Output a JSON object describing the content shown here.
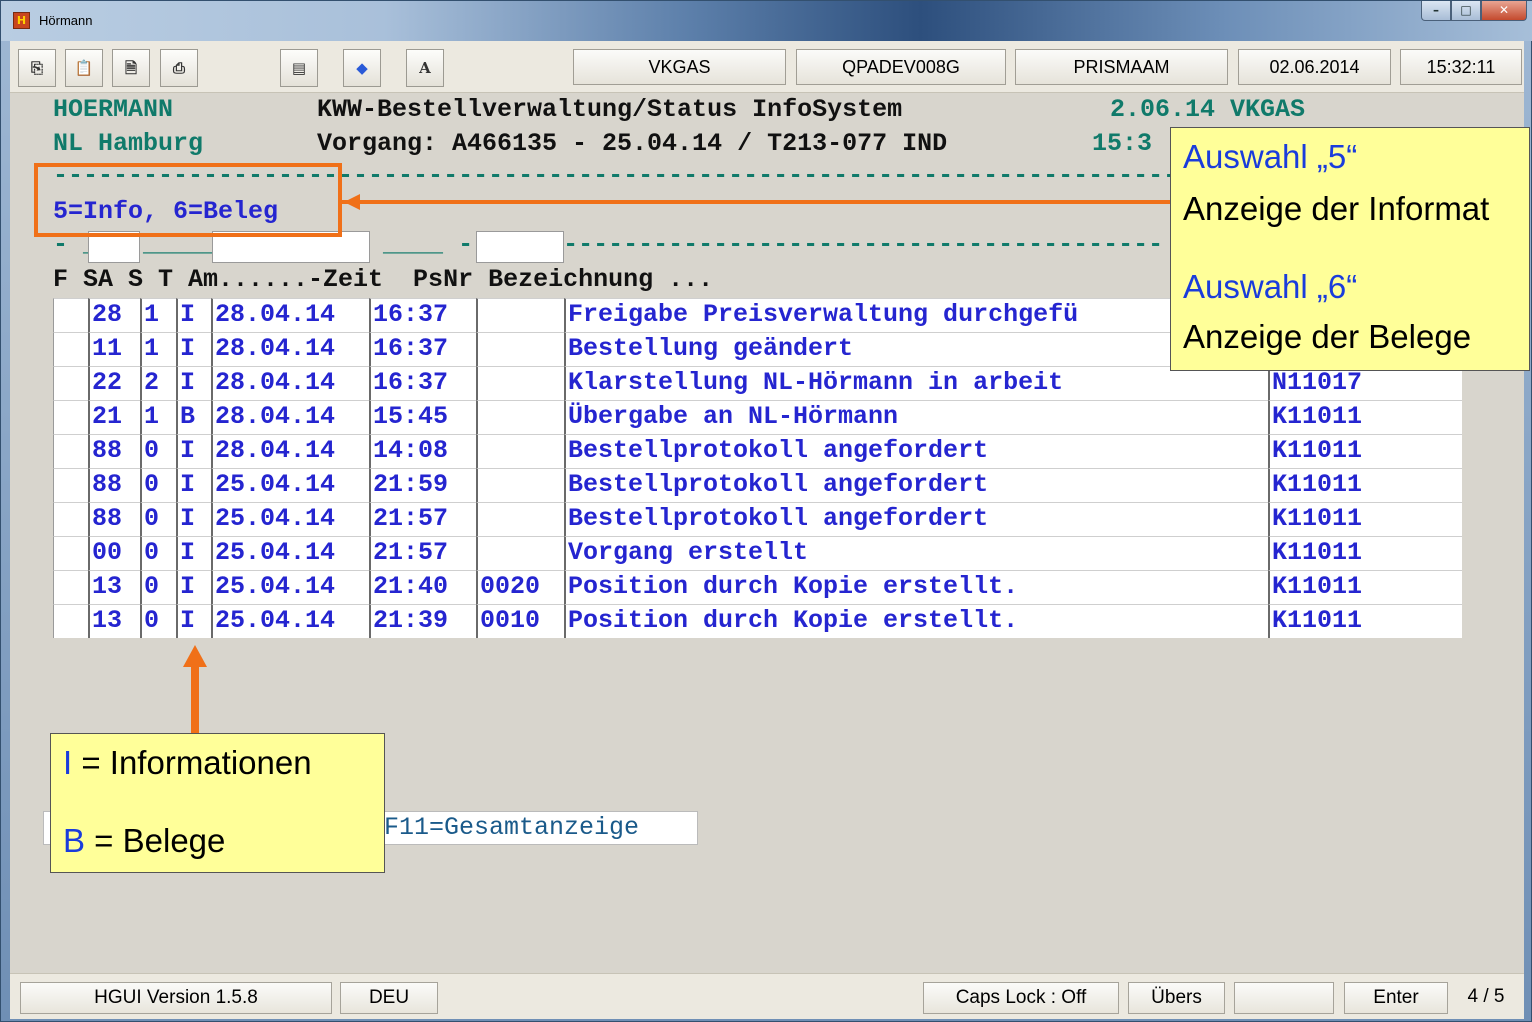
{
  "window": {
    "title": "Hörmann",
    "icon": "app-icon"
  },
  "toolbar": {
    "buttons": [
      "copy-icon",
      "paste-icon",
      "print-icon",
      "print-preview-icon",
      "print-screen-icon",
      "diamond-icon",
      "font-icon"
    ],
    "font_label": "A",
    "system": "VKGAS",
    "device": "QPADEV008G",
    "user": "PRISMAAM",
    "date": "02.06.2014",
    "time": "15:32:11"
  },
  "screen": {
    "company": "HOERMANN",
    "branch": "NL Hamburg",
    "title": "KWW-Bestellverwaltung/Status InfoSystem",
    "header_right": "2.06.14 VKGAS",
    "process_line": "Vorgang: A466135 - 25.04.14 / T213-077 IND",
    "process_time": "15:3",
    "options": "5=Info, 6=Beleg",
    "columns": "F SA S T Am......-Zeit  PsNr Bezeichnung ...",
    "rows": [
      {
        "sa": "28",
        "s": "1",
        "t": "I",
        "date": "28.04.14",
        "time": "16:37",
        "psnr": "",
        "desc": "Freigabe Preisverwaltung durchgefü",
        "user": ""
      },
      {
        "sa": "11",
        "s": "1",
        "t": "I",
        "date": "28.04.14",
        "time": "16:37",
        "psnr": "",
        "desc": "Bestellung geändert",
        "user": ""
      },
      {
        "sa": "22",
        "s": "2",
        "t": "I",
        "date": "28.04.14",
        "time": "16:37",
        "psnr": "",
        "desc": "Klarstellung NL-Hörmann in arbeit",
        "user": "N11017"
      },
      {
        "sa": "21",
        "s": "1",
        "t": "B",
        "date": "28.04.14",
        "time": "15:45",
        "psnr": "",
        "desc": "Übergabe an NL-Hörmann",
        "user": "K11011"
      },
      {
        "sa": "88",
        "s": "0",
        "t": "I",
        "date": "28.04.14",
        "time": "14:08",
        "psnr": "",
        "desc": "Bestellprotokoll angefordert",
        "user": "K11011"
      },
      {
        "sa": "88",
        "s": "0",
        "t": "I",
        "date": "25.04.14",
        "time": "21:59",
        "psnr": "",
        "desc": "Bestellprotokoll angefordert",
        "user": "K11011"
      },
      {
        "sa": "88",
        "s": "0",
        "t": "I",
        "date": "25.04.14",
        "time": "21:57",
        "psnr": "",
        "desc": "Bestellprotokoll angefordert",
        "user": "K11011"
      },
      {
        "sa": "00",
        "s": "0",
        "t": "I",
        "date": "25.04.14",
        "time": "21:57",
        "psnr": "",
        "desc": "Vorgang erstellt",
        "user": "K11011"
      },
      {
        "sa": "13",
        "s": "0",
        "t": "I",
        "date": "25.04.14",
        "time": "21:40",
        "psnr": "0020",
        "desc": "Position durch Kopie erstellt.",
        "user": "K11011"
      },
      {
        "sa": "13",
        "s": "0",
        "t": "I",
        "date": "25.04.14",
        "time": "21:39",
        "psnr": "0010",
        "desc": "Position durch Kopie erstellt.",
        "user": "K11011"
      }
    ],
    "fkeys": "F11=Gesamtanzeige"
  },
  "callouts": {
    "right": {
      "line1_key": "Auswahl „5“",
      "line1_desc": "Anzeige der Informat",
      "line2_key": "Auswahl „6“",
      "line2_desc": "Anzeige der Belege"
    },
    "left": {
      "i_key": "I",
      "i_desc": " = Informationen",
      "b_key": "B",
      "b_desc": " = Belege"
    }
  },
  "statusbar": {
    "version": "HGUI Version 1.5.8",
    "language": "DEU",
    "caps_lock": "Caps Lock : Off",
    "mode": "Übers",
    "enter": "Enter",
    "page": "4 / 5"
  }
}
